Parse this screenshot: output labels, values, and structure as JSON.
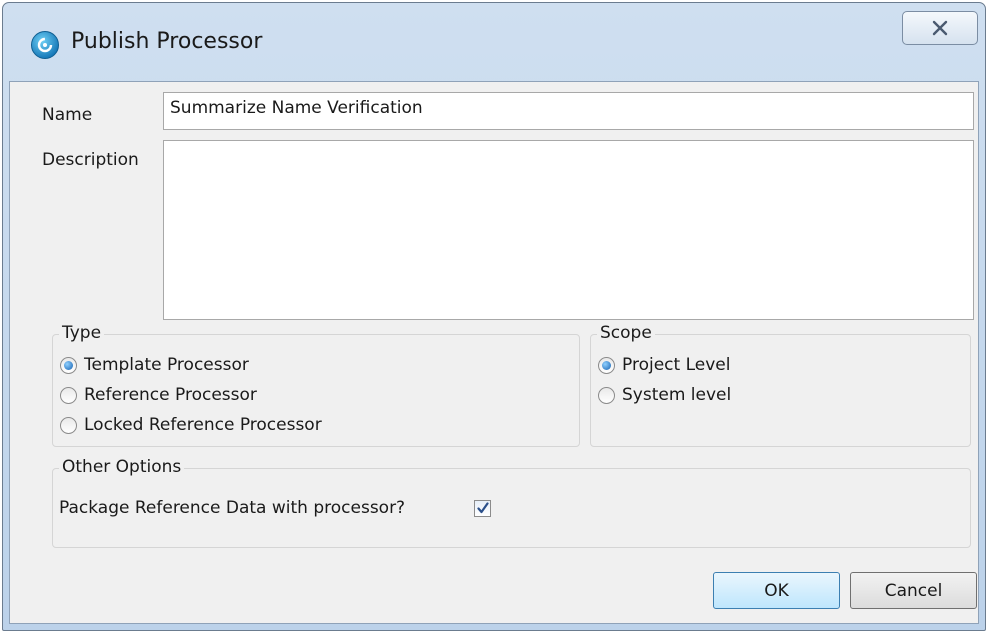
{
  "window": {
    "title": "Publish Processor",
    "close_glyph": "☒"
  },
  "form": {
    "name_label": "Name",
    "name_value": "Summarize Name Verification",
    "description_label": "Description",
    "description_value": ""
  },
  "type_group": {
    "title": "Type",
    "options": [
      {
        "label": "Template Processor",
        "checked": true
      },
      {
        "label": "Reference Processor",
        "checked": false
      },
      {
        "label": "Locked Reference Processor",
        "checked": false
      }
    ]
  },
  "scope_group": {
    "title": "Scope",
    "options": [
      {
        "label": "Project Level",
        "checked": true
      },
      {
        "label": "System level",
        "checked": false
      }
    ]
  },
  "other_options": {
    "title": "Other Options",
    "package_label": "Package Reference Data with processor?",
    "package_checked": true
  },
  "buttons": {
    "ok": "OK",
    "cancel": "Cancel"
  },
  "icons": {
    "app": "app-logo-icon",
    "close": "close-icon",
    "check": "checkmark-icon"
  },
  "colors": {
    "title_bar": "#bcd2ea",
    "client_bg": "#f0f0f0",
    "default_button": "#bee6fd"
  }
}
